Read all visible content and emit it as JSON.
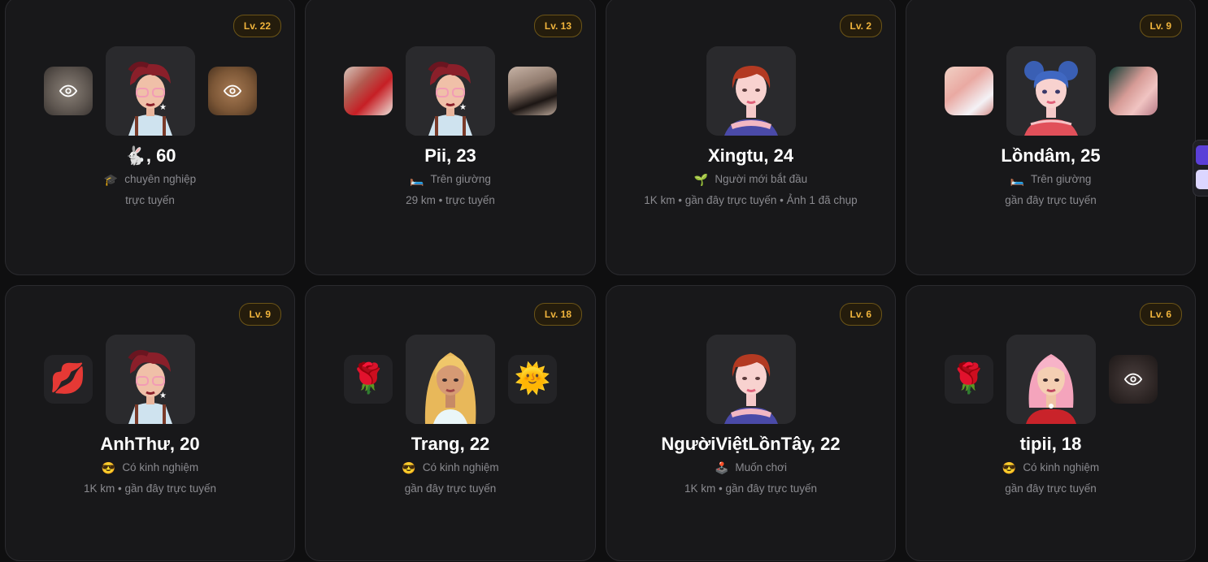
{
  "cards": [
    {
      "level": "Lv. 22",
      "name": "🐇, 60",
      "status_icon": "🎓",
      "status": "chuyên nghiệp",
      "meta": "trực tuyến",
      "left": {
        "kind": "blur-eye",
        "style": "blur1"
      },
      "right": {
        "kind": "blur-eye",
        "style": "blur2"
      },
      "avatar": "redhair-glasses"
    },
    {
      "level": "Lv. 13",
      "name": "Pii, 23",
      "status_icon": "🛏️",
      "status": "Trên giường",
      "meta": "29 km • trực tuyến",
      "left": {
        "kind": "photo",
        "style": "photo1"
      },
      "right": {
        "kind": "photo",
        "style": "photo2"
      },
      "avatar": "redhair-glasses"
    },
    {
      "level": "Lv. 2",
      "name": "Xingtu, 24",
      "status_icon": "🌱",
      "status": "Người mới bắt đầu",
      "meta": "1K km • gần đây trực tuyến • Ảnh 1 đã chụp",
      "left": null,
      "right": null,
      "avatar": "short-red"
    },
    {
      "level": "Lv. 9",
      "name": "Lồndâm󠇴, 25",
      "status_icon": "🛏️",
      "status": "Trên giường",
      "meta": "gần đây trực tuyến",
      "left": {
        "kind": "photo",
        "style": "photo3"
      },
      "right": {
        "kind": "photo",
        "style": "photo4"
      },
      "avatar": "blue-buns"
    },
    {
      "level": "Lv. 9",
      "name": "AnhThư, 20",
      "status_icon": "😎",
      "status": "Có kinh nghiệm",
      "meta": "1K km • gần đây trực tuyến",
      "left": {
        "kind": "emoji",
        "emoji": "💋"
      },
      "right": null,
      "avatar": "redhair-glasses"
    },
    {
      "level": "Lv. 18",
      "name": "Trang, 22",
      "status_icon": "😎",
      "status": "Có kinh nghiệm",
      "meta": "gần đây trực tuyến",
      "left": {
        "kind": "emoji",
        "emoji": "🌹"
      },
      "right": {
        "kind": "emoji",
        "emoji": "🌞"
      },
      "avatar": "blonde"
    },
    {
      "level": "Lv. 6",
      "name": "NgườiViệtLồnTây, 22",
      "status_icon": "🕹️",
      "status": "Muốn chơi",
      "meta": "1K km • gần đây trực tuyến",
      "left": null,
      "right": null,
      "avatar": "short-red"
    },
    {
      "level": "Lv. 6",
      "name": "tipii, 18",
      "status_icon": "😎",
      "status": "Có kinh nghiệm",
      "meta": "gần đây trực tuyến",
      "left": {
        "kind": "emoji",
        "emoji": "🌹"
      },
      "right": {
        "kind": "blur-eye",
        "style": "blur3"
      },
      "avatar": "pink-hair"
    }
  ],
  "colors": {
    "level_text": "#f0b43c",
    "card_bg": "#18181a",
    "page_bg": "#0f0f10"
  }
}
